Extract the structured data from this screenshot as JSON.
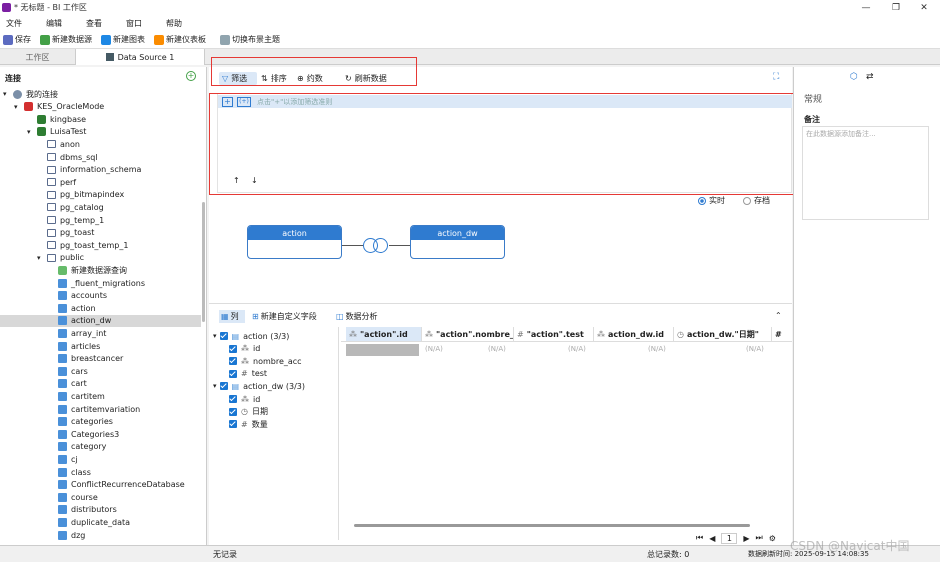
{
  "title": "* 无标题 - BI 工作区",
  "menu": [
    "文件",
    "编辑",
    "查看",
    "窗口",
    "帮助"
  ],
  "toolbar": {
    "save": "保存",
    "new_datasource": "新建数据源",
    "new_chart": "新建图表",
    "new_dashboard": "新建仪表板",
    "switch_theme": "切换布景主题"
  },
  "tabs": {
    "workspace": "工作区",
    "datasource": "Data Source 1"
  },
  "left": {
    "header": "连接",
    "tree": [
      {
        "label": "我的连接",
        "indent": 0,
        "icon": "connections-icon",
        "arrow": "▾"
      },
      {
        "label": "KES_OracleMode",
        "indent": 1,
        "icon": "kes-icon",
        "arrow": "▾"
      },
      {
        "label": "kingbase",
        "indent": 2,
        "icon": "database-icon",
        "arrow": ""
      },
      {
        "label": "LuisaTest",
        "indent": 2,
        "icon": "database-icon",
        "arrow": "▾"
      },
      {
        "label": "anon",
        "indent": 3,
        "icon": "schema-icon",
        "arrow": ""
      },
      {
        "label": "dbms_sql",
        "indent": 3,
        "icon": "schema-icon",
        "arrow": ""
      },
      {
        "label": "information_schema",
        "indent": 3,
        "icon": "schema-icon",
        "arrow": ""
      },
      {
        "label": "perf",
        "indent": 3,
        "icon": "schema-icon",
        "arrow": ""
      },
      {
        "label": "pg_bitmapindex",
        "indent": 3,
        "icon": "schema-icon",
        "arrow": ""
      },
      {
        "label": "pg_catalog",
        "indent": 3,
        "icon": "schema-icon",
        "arrow": ""
      },
      {
        "label": "pg_temp_1",
        "indent": 3,
        "icon": "schema-icon",
        "arrow": ""
      },
      {
        "label": "pg_toast",
        "indent": 3,
        "icon": "schema-icon",
        "arrow": ""
      },
      {
        "label": "pg_toast_temp_1",
        "indent": 3,
        "icon": "schema-icon",
        "arrow": ""
      },
      {
        "label": "public",
        "indent": 3,
        "icon": "schema-icon",
        "arrow": "▾"
      },
      {
        "label": "新建数据源查询",
        "indent": 4,
        "icon": "new-query-icon",
        "arrow": ""
      },
      {
        "label": "_fluent_migrations",
        "indent": 4,
        "icon": "table-icon",
        "arrow": ""
      },
      {
        "label": "accounts",
        "indent": 4,
        "icon": "table-icon",
        "arrow": ""
      },
      {
        "label": "action",
        "indent": 4,
        "icon": "table-icon",
        "arrow": ""
      },
      {
        "label": "action_dw",
        "indent": 4,
        "icon": "table-icon",
        "arrow": "",
        "selected": true
      },
      {
        "label": "array_int",
        "indent": 4,
        "icon": "table-icon",
        "arrow": ""
      },
      {
        "label": "articles",
        "indent": 4,
        "icon": "table-icon",
        "arrow": ""
      },
      {
        "label": "breastcancer",
        "indent": 4,
        "icon": "table-icon",
        "arrow": ""
      },
      {
        "label": "cars",
        "indent": 4,
        "icon": "table-icon",
        "arrow": ""
      },
      {
        "label": "cart",
        "indent": 4,
        "icon": "table-icon",
        "arrow": ""
      },
      {
        "label": "cartitem",
        "indent": 4,
        "icon": "table-icon",
        "arrow": ""
      },
      {
        "label": "cartitemvariation",
        "indent": 4,
        "icon": "table-icon",
        "arrow": ""
      },
      {
        "label": "categories",
        "indent": 4,
        "icon": "table-icon",
        "arrow": ""
      },
      {
        "label": "Categories3",
        "indent": 4,
        "icon": "table-icon",
        "arrow": ""
      },
      {
        "label": "category",
        "indent": 4,
        "icon": "table-icon",
        "arrow": ""
      },
      {
        "label": "cj",
        "indent": 4,
        "icon": "table-icon",
        "arrow": ""
      },
      {
        "label": "class",
        "indent": 4,
        "icon": "table-icon",
        "arrow": ""
      },
      {
        "label": "ConflictRecurrenceDatabase",
        "indent": 4,
        "icon": "table-icon",
        "arrow": ""
      },
      {
        "label": "course",
        "indent": 4,
        "icon": "table-icon",
        "arrow": ""
      },
      {
        "label": "distributors",
        "indent": 4,
        "icon": "table-icon",
        "arrow": ""
      },
      {
        "label": "duplicate_data",
        "indent": 4,
        "icon": "table-icon",
        "arrow": ""
      },
      {
        "label": "dzg",
        "indent": 4,
        "icon": "table-icon",
        "arrow": ""
      }
    ]
  },
  "main": {
    "tabs": {
      "filter": "筛选",
      "sort": "排序",
      "limit": "约数",
      "refresh": "刷新数据"
    },
    "filter_hint": "点击\"+\"以添加筛选准则",
    "mode": {
      "live": "实时",
      "stored": "存档"
    },
    "nodes": {
      "left": "action",
      "right": "action_dw"
    },
    "bottom_tabs": {
      "columns": "列",
      "new_field": "新建自定义字段",
      "analysis": "数据分析"
    },
    "fields": [
      {
        "label": "action (3/3)",
        "level": 0,
        "icon": "table-icon"
      },
      {
        "label": "id",
        "level": 1,
        "icon": "text-type-icon"
      },
      {
        "label": "nombre_acc",
        "level": 1,
        "icon": "text-type-icon"
      },
      {
        "label": "test",
        "level": 1,
        "icon": "number-type-icon"
      },
      {
        "label": "action_dw (3/3)",
        "level": 0,
        "icon": "table-icon"
      },
      {
        "label": "id",
        "level": 1,
        "icon": "text-type-icon"
      },
      {
        "label": "日期",
        "level": 1,
        "icon": "date-type-icon"
      },
      {
        "label": "数量",
        "level": 1,
        "icon": "number-type-icon"
      }
    ],
    "columns": [
      {
        "label": "\"action\".id",
        "type": "Abc"
      },
      {
        "label": "\"action\".nombre_ac",
        "type": "Abc"
      },
      {
        "label": "\"action\".test",
        "type": "#"
      },
      {
        "label": "action_dw.id",
        "type": "Abc"
      },
      {
        "label": "action_dw.\"日期\"",
        "type": "◷"
      },
      {
        "label": "#",
        "type": ""
      }
    ],
    "na": "(N/A)",
    "page": "1"
  },
  "right": {
    "general": "常规",
    "note_label": "备注",
    "note_placeholder": "在此数据源添加备注..."
  },
  "status": {
    "left": "无记录",
    "count": "总记录数: 0",
    "refresh": "数据刷新时间: 2025-09-15 14:08:35",
    "watermark": "CSDN @Navicat中国"
  },
  "colors": {
    "accent": "#2f7bd0",
    "highlight": "#e53935"
  }
}
